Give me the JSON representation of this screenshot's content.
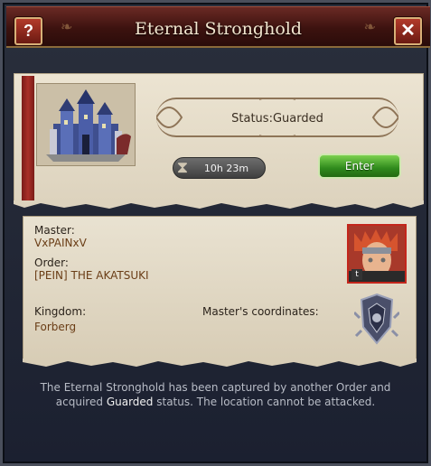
{
  "window": {
    "title": "Eternal Stronghold",
    "help_label": "?",
    "close_label": "✕"
  },
  "stronghold": {
    "status_prefix": "Status:",
    "status_value": "Guarded",
    "timer": "10h 23m",
    "enter_label": "Enter"
  },
  "info": {
    "master_label": "Master:",
    "master_value": "VxPAINxV",
    "order_label": "Order:",
    "order_value": "[PEIN] THE AKATSUKI",
    "kingdom_label": "Kingdom:",
    "kingdom_value": "Forberg",
    "coords_label": "Master's coordinates:",
    "avatar_badge": "t"
  },
  "footer": {
    "line1": "The Eternal Stronghold has been captured by another Order and",
    "line2_prefix": "acquired",
    "line2_highlight": "Guarded",
    "line2_suffix": "status. The location cannot be attacked."
  },
  "colors": {
    "title_bar": "#3c120f",
    "enter_button": "#2f8a1c",
    "ribbon": "#a93028",
    "value_text": "#6a3d16"
  },
  "icons": [
    "help-icon",
    "close-icon",
    "castle-icon",
    "hourglass-icon",
    "avatar-image",
    "order-emblem-icon"
  ]
}
